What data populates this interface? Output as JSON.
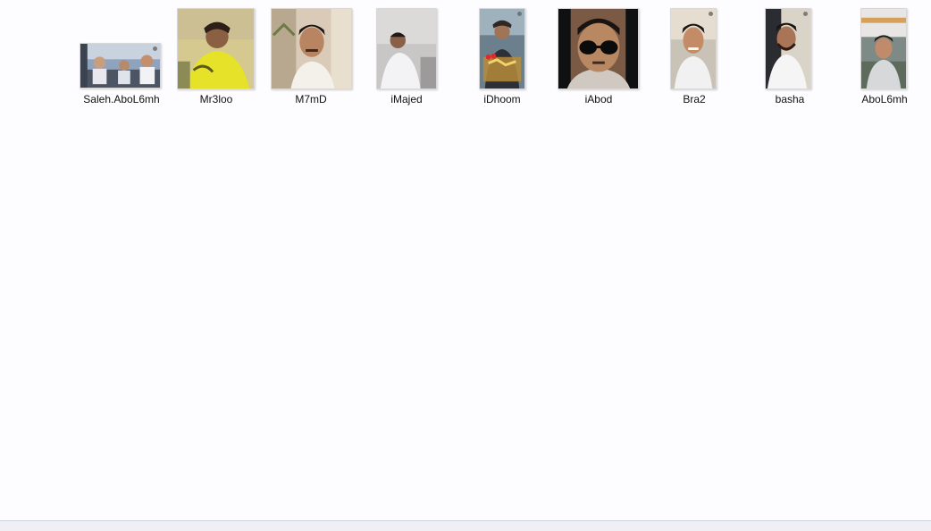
{
  "files": [
    {
      "name": "Saleh.AboL6mh",
      "icon": "image-thumbnail-icon"
    },
    {
      "name": "Mr3loo",
      "icon": "image-thumbnail-icon"
    },
    {
      "name": "M7mD",
      "icon": "image-thumbnail-icon"
    },
    {
      "name": "iMajed",
      "icon": "image-thumbnail-icon"
    },
    {
      "name": "iDhoom",
      "icon": "image-thumbnail-icon"
    },
    {
      "name": "iAbod",
      "icon": "image-thumbnail-icon"
    },
    {
      "name": "Bra2",
      "icon": "image-thumbnail-icon"
    },
    {
      "name": "basha",
      "icon": "image-thumbnail-icon"
    },
    {
      "name": "AboL6mh",
      "icon": "image-thumbnail-icon"
    }
  ],
  "colors": {
    "background": "#fdfcfe",
    "status_border": "#c9d6e7"
  }
}
